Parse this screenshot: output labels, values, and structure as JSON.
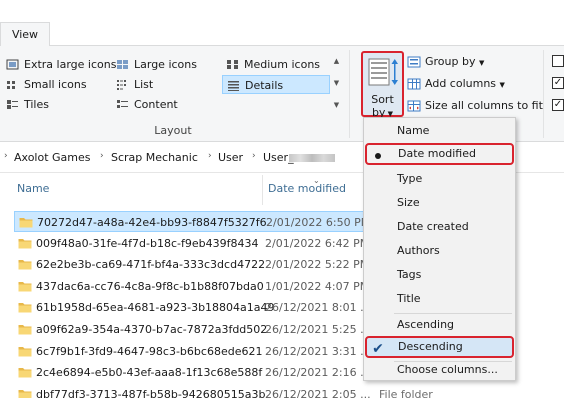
{
  "ribbon": {
    "tab_view": "View",
    "layout": {
      "options": [
        {
          "label": "Extra large icons",
          "icon": "extra-large-icons-icon"
        },
        {
          "label": "Large icons",
          "icon": "large-icons-icon"
        },
        {
          "label": "Medium icons",
          "icon": "medium-icons-icon"
        },
        {
          "label": "Small icons",
          "icon": "small-icons-icon"
        },
        {
          "label": "List",
          "icon": "list-icon"
        },
        {
          "label": "Details",
          "icon": "details-icon",
          "selected": true
        },
        {
          "label": "Tiles",
          "icon": "tiles-icon"
        },
        {
          "label": "Content",
          "icon": "content-icon"
        }
      ],
      "group_label": "Layout"
    },
    "sort_by": {
      "line1": "Sort",
      "line2": "by"
    },
    "group_by": "Group by",
    "add_columns": "Add columns",
    "size_all_columns": "Size all columns to fit"
  },
  "address_bar": {
    "crumbs": [
      "Axolot Games",
      "Scrap Mechanic",
      "User",
      "User_"
    ]
  },
  "columns": {
    "name": "Name",
    "date_modified": "Date modified"
  },
  "files": [
    {
      "name": "70272d47-a48a-42e4-bb93-f8847f5327f6",
      "date": "2/01/2022 6:50 PM",
      "selected": true
    },
    {
      "name": "009f48a0-31fe-4f7d-b18c-f9eb439f8434",
      "date": "2/01/2022 6:42 PM"
    },
    {
      "name": "62e2be3b-ca69-471f-bf4a-333c3dcd4722",
      "date": "2/01/2022 5:22 PM"
    },
    {
      "name": "437dac6a-cc76-4c8a-9f8c-b1b88f07bda0",
      "date": "1/01/2022 4:07 PM"
    },
    {
      "name": "61b1958d-65ea-4681-a923-3b18804a1a49",
      "date": "26/12/2021 8:01 ..."
    },
    {
      "name": "a09f62a9-354a-4370-b7ac-7872a3fdd502",
      "date": "26/12/2021 5:25 ..."
    },
    {
      "name": "6c7f9b1f-3fd9-4647-98c3-b6bc68ede621",
      "date": "26/12/2021 3:31 ..."
    },
    {
      "name": "2c4e6894-e5b0-43ef-aaa8-1f13c68e588f",
      "date": "26/12/2021 2:16 ..."
    },
    {
      "name": "dbf77df3-3713-487f-b58b-942680515a3b",
      "date": "26/12/2021 2:05 ...",
      "type": "File folder"
    }
  ],
  "sort_menu": {
    "items": [
      {
        "label": "Name"
      },
      {
        "label": "Date modified",
        "checked": "bullet",
        "highlight": true
      },
      {
        "label": "Type"
      },
      {
        "label": "Size"
      },
      {
        "label": "Date created"
      },
      {
        "label": "Authors"
      },
      {
        "label": "Tags"
      },
      {
        "label": "Title"
      }
    ],
    "order": [
      {
        "label": "Ascending"
      },
      {
        "label": "Descending",
        "checked": "check",
        "highlight": true
      }
    ],
    "choose_columns": "Choose columns..."
  },
  "colors": {
    "selection": "#cce8ff",
    "highlight_outline": "#d9232e",
    "folder": "#f8d775",
    "header_text": "#3f6e94"
  }
}
